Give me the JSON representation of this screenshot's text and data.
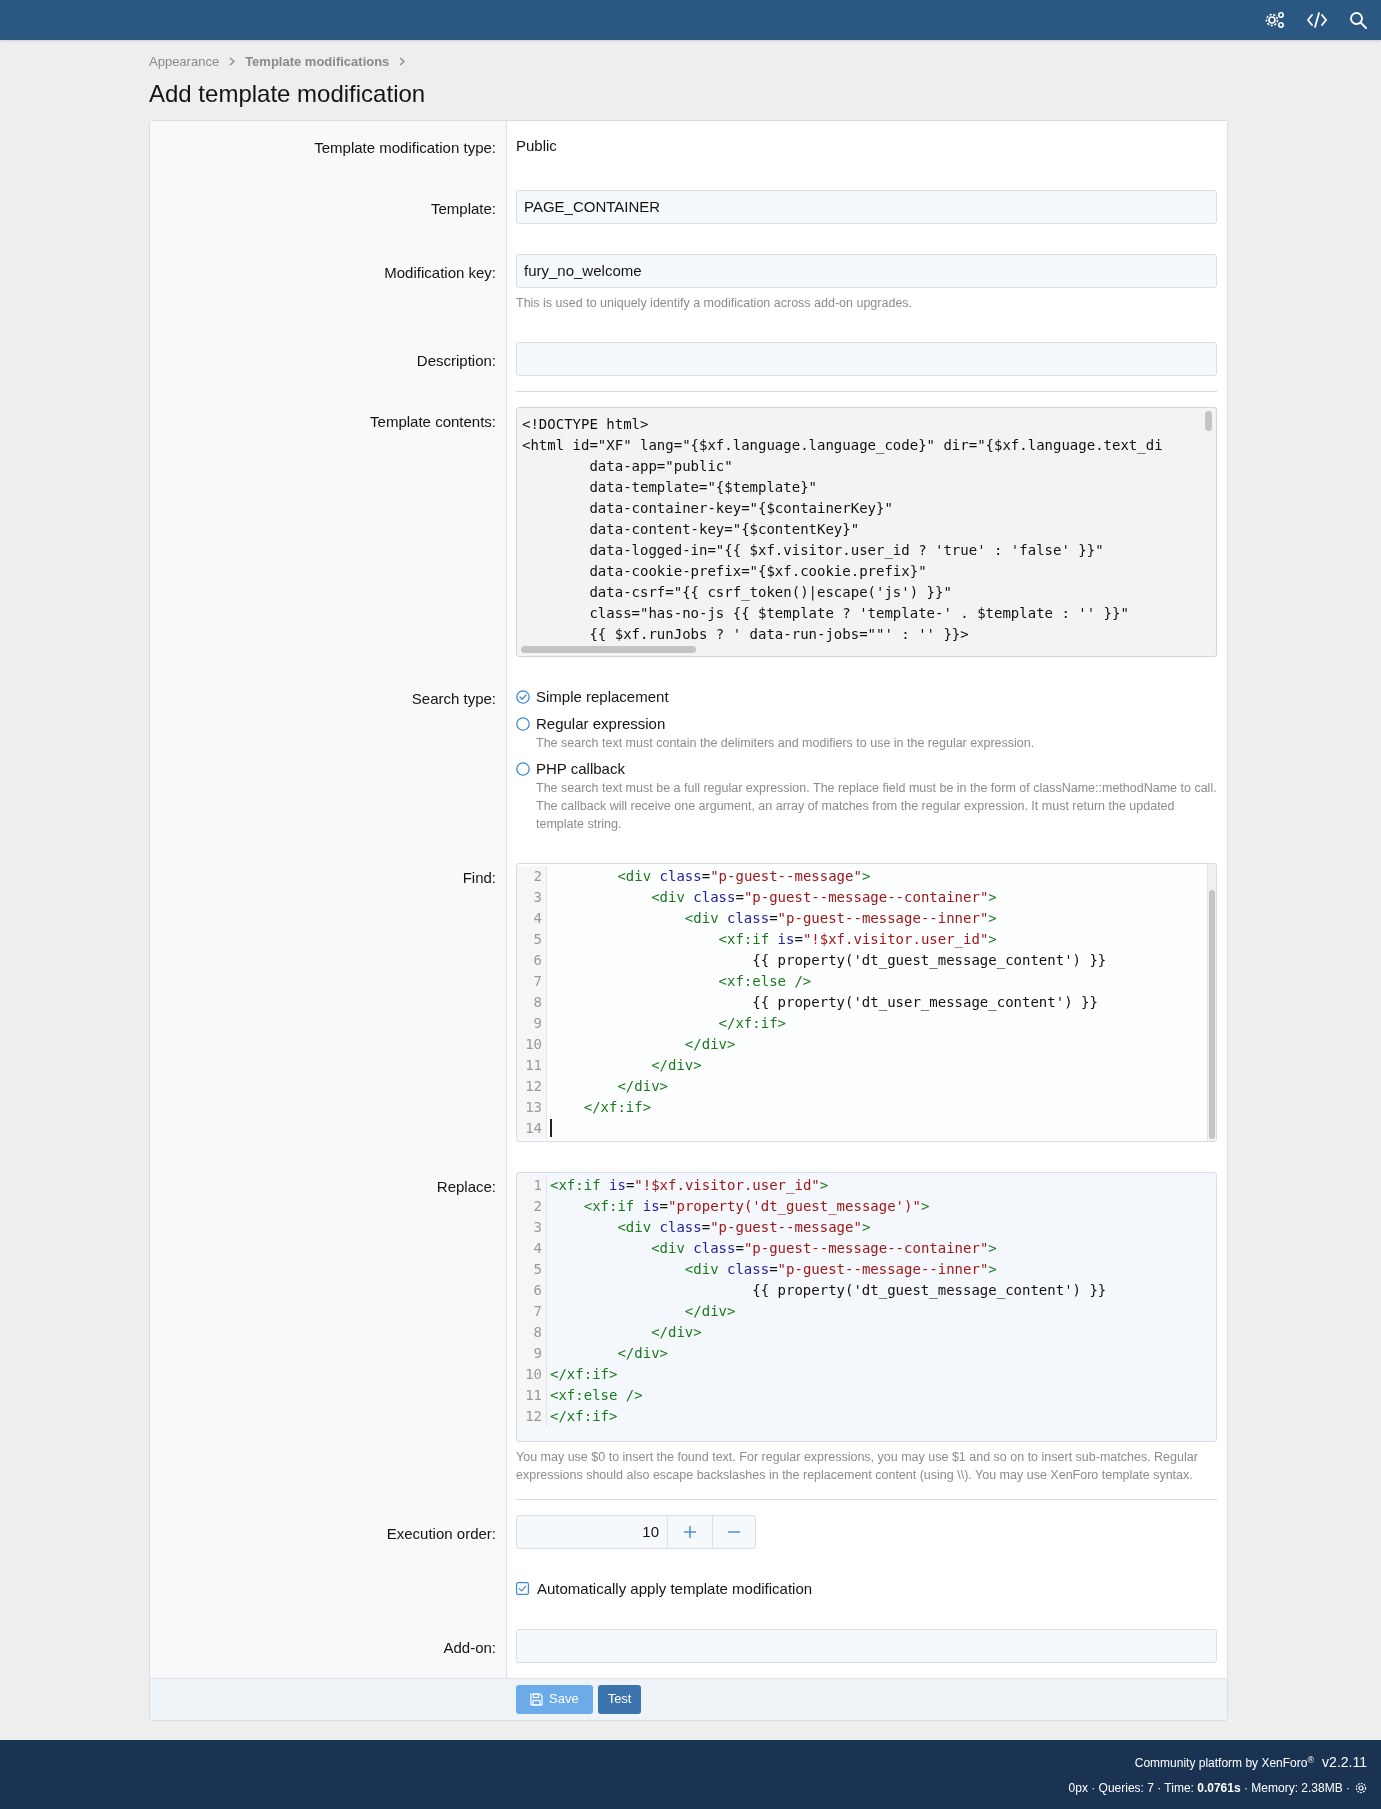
{
  "breadcrumb": [
    "Appearance",
    "Template modifications"
  ],
  "page_title": "Add template modification",
  "sections": [
    [
      {
        "kind": "text",
        "label": "Template modification type:",
        "value": "Public"
      },
      {
        "kind": "input",
        "label": "Template:",
        "value": "PAGE_CONTAINER"
      },
      {
        "kind": "input",
        "label": "Modification key:",
        "value": "fury_no_welcome",
        "hint": "This is used to uniquely identify a modification across add-on upgrades."
      },
      {
        "kind": "input",
        "label": "Description:"
      }
    ],
    [
      {
        "kind": "plain_code",
        "label": "Template contents:",
        "lines": [
          "<!DOCTYPE html>",
          "<html id=\"XF\" lang=\"{$xf.language.language_code}\" dir=\"{$xf.language.text_di",
          "        data-app=\"public\"",
          "        data-template=\"{$template}\"",
          "        data-container-key=\"{$containerKey}\"",
          "        data-content-key=\"{$contentKey}\"",
          "        data-logged-in=\"{{ $xf.visitor.user_id ? 'true' : 'false' }}\"",
          "        data-cookie-prefix=\"{$xf.cookie.prefix}\"",
          "        data-csrf=\"{{ csrf_token()|escape('js') }}\"",
          "        class=\"has-no-js {{ $template ? 'template-' . $template : '' }}\"",
          "        {{ $xf.runJobs ? ' data-run-jobs=\"\"' : '' }}>"
        ]
      },
      {
        "kind": "radio",
        "label": "Search type:",
        "options": [
          {
            "label": "Simple replacement",
            "selected": true
          },
          {
            "label": "Regular expression",
            "selected": false,
            "hint": "The search text must contain the delimiters and modifiers to use in the regular expression."
          },
          {
            "label": "PHP callback",
            "selected": false,
            "hint": "The search text must be a full regular expression. The replace field must be in the form of className::methodName to call. The callback will receive one argument, an array of matches from the regular expression. It must return the updated template string."
          }
        ]
      },
      {
        "kind": "code",
        "label": "Find:",
        "scrollbar": true,
        "lines": [
          {
            "number": "2",
            "tokens": [
              {
                "kind": "tag",
                "t": "        <div"
              },
              {
                "kind": "attr",
                "t": " class"
              },
              {
                "kind": "plain",
                "t": "="
              },
              {
                "kind": "string",
                "t": "\"p-guest--message\""
              },
              {
                "kind": "tag",
                "t": ">"
              }
            ]
          },
          {
            "number": "3",
            "tokens": [
              {
                "kind": "tag",
                "t": "            <div"
              },
              {
                "kind": "attr",
                "t": " class"
              },
              {
                "kind": "plain",
                "t": "="
              },
              {
                "kind": "string",
                "t": "\"p-guest--message--container\""
              },
              {
                "kind": "tag",
                "t": ">"
              }
            ]
          },
          {
            "number": "4",
            "tokens": [
              {
                "kind": "tag",
                "t": "                <div"
              },
              {
                "kind": "attr",
                "t": " class"
              },
              {
                "kind": "plain",
                "t": "="
              },
              {
                "kind": "string",
                "t": "\"p-guest--message--inner\""
              },
              {
                "kind": "tag",
                "t": ">"
              }
            ]
          },
          {
            "number": "5",
            "tokens": [
              {
                "kind": "tag",
                "t": "                    <xf:if"
              },
              {
                "kind": "attr",
                "t": " is"
              },
              {
                "kind": "plain",
                "t": "="
              },
              {
                "kind": "string",
                "t": "\"!$xf.visitor.user_id\""
              },
              {
                "kind": "tag",
                "t": ">"
              }
            ]
          },
          {
            "number": "6",
            "tokens": [
              {
                "kind": "plain",
                "t": "                        {{ property('dt_guest_message_content') }}"
              }
            ]
          },
          {
            "number": "7",
            "tokens": [
              {
                "kind": "tag",
                "t": "                    <xf:else />"
              }
            ]
          },
          {
            "number": "8",
            "tokens": [
              {
                "kind": "plain",
                "t": "                        {{ property('dt_user_message_content') }}"
              }
            ]
          },
          {
            "number": "9",
            "tokens": [
              {
                "kind": "tag",
                "t": "                    </xf:if>"
              }
            ]
          },
          {
            "number": "10",
            "tokens": [
              {
                "kind": "tag",
                "t": "                </div>"
              }
            ]
          },
          {
            "number": "11",
            "tokens": [
              {
                "kind": "tag",
                "t": "            </div>"
              }
            ]
          },
          {
            "number": "12",
            "tokens": [
              {
                "kind": "tag",
                "t": "        </div>"
              }
            ]
          },
          {
            "number": "13",
            "tokens": [
              {
                "kind": "tag",
                "t": "    </xf:if>"
              }
            ]
          },
          {
            "number": "14",
            "cursor": true
          }
        ]
      },
      {
        "kind": "code",
        "label": "Replace:",
        "hint": "You may use $0 to insert the found text. For regular expressions, you may use $1 and so on to insert sub-matches. Regular expressions should also escape backslashes in the replacement content (using \\\\). You may use XenForo template syntax.",
        "lines": [
          {
            "number": "1",
            "tokens": [
              {
                "kind": "tag",
                "t": "<xf:if"
              },
              {
                "kind": "attr",
                "t": " is"
              },
              {
                "kind": "plain",
                "t": "="
              },
              {
                "kind": "string",
                "t": "\"!$xf.visitor.user_id\""
              },
              {
                "kind": "tag",
                "t": ">"
              }
            ]
          },
          {
            "number": "2",
            "tokens": [
              {
                "kind": "tag",
                "t": "    <xf:if"
              },
              {
                "kind": "attr",
                "t": " is"
              },
              {
                "kind": "plain",
                "t": "="
              },
              {
                "kind": "string",
                "t": "\"property('dt_guest_message')\""
              },
              {
                "kind": "tag",
                "t": ">"
              }
            ]
          },
          {
            "number": "3",
            "tokens": [
              {
                "kind": "tag",
                "t": "        <div"
              },
              {
                "kind": "attr",
                "t": " class"
              },
              {
                "kind": "plain",
                "t": "="
              },
              {
                "kind": "string",
                "t": "\"p-guest--message\""
              },
              {
                "kind": "tag",
                "t": ">"
              }
            ]
          },
          {
            "number": "4",
            "tokens": [
              {
                "kind": "tag",
                "t": "            <div"
              },
              {
                "kind": "attr",
                "t": " class"
              },
              {
                "kind": "plain",
                "t": "="
              },
              {
                "kind": "string",
                "t": "\"p-guest--message--container\""
              },
              {
                "kind": "tag",
                "t": ">"
              }
            ]
          },
          {
            "number": "5",
            "tokens": [
              {
                "kind": "tag",
                "t": "                <div"
              },
              {
                "kind": "attr",
                "t": " class"
              },
              {
                "kind": "plain",
                "t": "="
              },
              {
                "kind": "string",
                "t": "\"p-guest--message--inner\""
              },
              {
                "kind": "tag",
                "t": ">"
              }
            ]
          },
          {
            "number": "6",
            "tokens": [
              {
                "kind": "plain",
                "t": "                        {{ property('dt_guest_message_content') }}"
              }
            ]
          },
          {
            "number": "7",
            "tokens": [
              {
                "kind": "tag",
                "t": "                </div>"
              }
            ]
          },
          {
            "number": "8",
            "tokens": [
              {
                "kind": "tag",
                "t": "            </div>"
              }
            ]
          },
          {
            "number": "9",
            "tokens": [
              {
                "kind": "tag",
                "t": "        </div>"
              }
            ]
          },
          {
            "number": "10",
            "tokens": [
              {
                "kind": "tag",
                "t": "</xf:if>"
              }
            ]
          },
          {
            "number": "11",
            "tokens": [
              {
                "kind": "tag",
                "t": "<xf:else />"
              }
            ]
          },
          {
            "number": "12",
            "tokens": [
              {
                "kind": "tag",
                "t": "</xf:if>"
              }
            ]
          }
        ]
      }
    ],
    [
      {
        "kind": "number",
        "label": "Execution order:",
        "value": "10"
      },
      {
        "kind": "checkbox",
        "label_text": "Automatically apply template modification",
        "checked": true
      },
      {
        "kind": "input",
        "label": "Add-on:"
      }
    ]
  ],
  "buttons": [
    {
      "kind": "primary",
      "label": "Save"
    },
    {
      "kind": "secondary",
      "label": "Test"
    }
  ],
  "footer": {
    "credit": "Community platform by XenForo$^{®}$",
    "version": "v2.2.11",
    "stats": "0px · Queries: 7 · Time: **0.0761s** · Memory: 2.38MB ·"
  }
}
